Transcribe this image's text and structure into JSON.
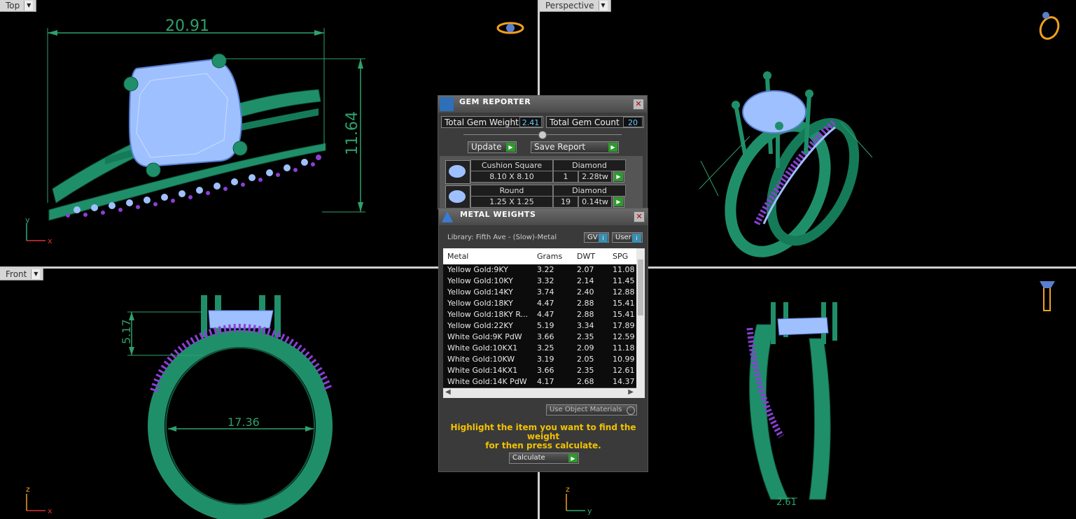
{
  "viewports": {
    "top": {
      "label": "Top",
      "axes": [
        "y",
        "x"
      ],
      "dim_width": "20.91",
      "dim_height": "11.64"
    },
    "perspective": {
      "label": "Perspective"
    },
    "front": {
      "label": "Front",
      "axes": [
        "z",
        "x"
      ],
      "dim_height": "5.17",
      "dim_inner": "17.36"
    },
    "right": {
      "axes": [
        "z",
        "y"
      ],
      "dim_width": "2.61"
    }
  },
  "gem_reporter": {
    "title": "GEM REPORTER",
    "total_weight_label": "Total Gem Weight",
    "total_weight": "2.41",
    "total_count_label": "Total Gem Count",
    "total_count": "20",
    "update_label": "Update",
    "save_label": "Save Report",
    "gems": [
      {
        "shape": "Cushion Square",
        "size": "8.10 X 8.10",
        "type": "Diamond",
        "count": "1",
        "weight": "2.28tw"
      },
      {
        "shape": "Round",
        "size": "1.25 X 1.25",
        "type": "Diamond",
        "count": "19",
        "weight": "0.14tw"
      }
    ]
  },
  "metal_weights": {
    "title": "METAL WEIGHTS",
    "library": "Library: Fifth Ave - (Slow)-Metal",
    "gv_label": "GV",
    "user_label": "User",
    "columns": [
      "Metal",
      "Grams",
      "DWT",
      "SPG"
    ],
    "rows": [
      [
        "Yellow Gold:9KY",
        "3.22",
        "2.07",
        "11.08"
      ],
      [
        "Yellow Gold:10KY",
        "3.32",
        "2.14",
        "11.45"
      ],
      [
        "Yellow Gold:14KY",
        "3.74",
        "2.40",
        "12.88"
      ],
      [
        "Yellow Gold:18KY",
        "4.47",
        "2.88",
        "15.41"
      ],
      [
        "Yellow Gold:18KY R...",
        "4.47",
        "2.88",
        "15.41"
      ],
      [
        "Yellow Gold:22KY",
        "5.19",
        "3.34",
        "17.89"
      ],
      [
        "White Gold:9K PdW",
        "3.66",
        "2.35",
        "12.59"
      ],
      [
        "White Gold:10KX1",
        "3.25",
        "2.09",
        "11.18"
      ],
      [
        "White Gold:10KW",
        "3.19",
        "2.05",
        "10.99"
      ],
      [
        "White Gold:14KX1",
        "3.66",
        "2.35",
        "12.61"
      ],
      [
        "White Gold:14K PdW",
        "4.17",
        "2.68",
        "14.37"
      ]
    ],
    "use_object_materials": "Use Object Materials",
    "note_line1": "Highlight the item you want to find the weight",
    "note_line2": "for then press calculate.",
    "calculate_label": "Calculate"
  },
  "colors": {
    "metal": "#1f8f6a",
    "metal_dark": "#0f5a40",
    "gem": "#9fc0ff",
    "pave": "#8b3fd6",
    "dimension": "#2fa06a",
    "note": "#f2c200"
  }
}
